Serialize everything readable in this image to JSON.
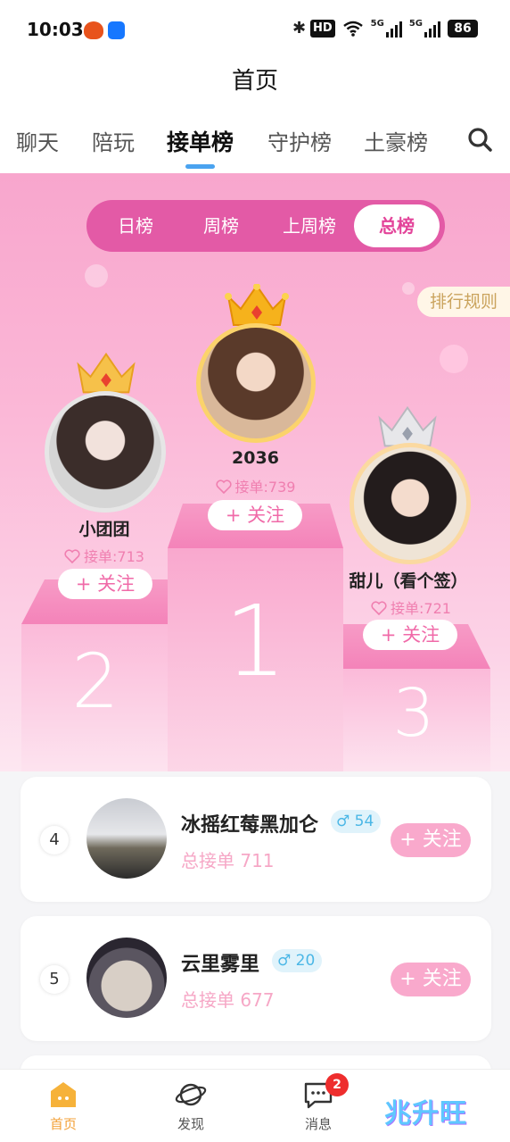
{
  "status_bar": {
    "time": "10:03",
    "hd": "HD",
    "net1": "5G",
    "net2": "5G",
    "battery": "86"
  },
  "header": {
    "title": "首页"
  },
  "tabs": [
    {
      "label": "聊天"
    },
    {
      "label": "陪玩"
    },
    {
      "label": "接单榜",
      "active": true
    },
    {
      "label": "守护榜"
    },
    {
      "label": "土豪榜"
    }
  ],
  "ranking": {
    "periods": [
      {
        "label": "日榜"
      },
      {
        "label": "周榜"
      },
      {
        "label": "上周榜"
      },
      {
        "label": "总榜",
        "active": true
      }
    ],
    "rules_label": "排行规则"
  },
  "podium": {
    "first": {
      "rank": "1",
      "name": "2036",
      "count": "接单:739",
      "follow": "+ 关注"
    },
    "second": {
      "rank": "2",
      "name": "小团团",
      "count": "接单:713",
      "follow": "+ 关注"
    },
    "third": {
      "rank": "3",
      "name": "甜儿（看个签）",
      "count": "接单:721",
      "follow": "+ 关注"
    }
  },
  "list": [
    {
      "rank": "4",
      "name": "冰摇红莓黑加仑",
      "level": "54",
      "count": "总接单 711",
      "follow": "+ 关注"
    },
    {
      "rank": "5",
      "name": "云里雾里",
      "level": "20",
      "count": "总接单 677",
      "follow": "+ 关注"
    }
  ],
  "bottom_nav": [
    {
      "label": "首页",
      "icon": "home-icon",
      "active": true
    },
    {
      "label": "发现",
      "icon": "planet-icon"
    },
    {
      "label": "消息",
      "icon": "message-icon",
      "badge": "2"
    }
  ],
  "watermark": "兆升旺",
  "colors": {
    "accent_pink": "#e35aa6",
    "tab_indicator": "#4aa3f0",
    "gender_blue": "#4bb7e6",
    "active_nav": "#f3a23a"
  }
}
